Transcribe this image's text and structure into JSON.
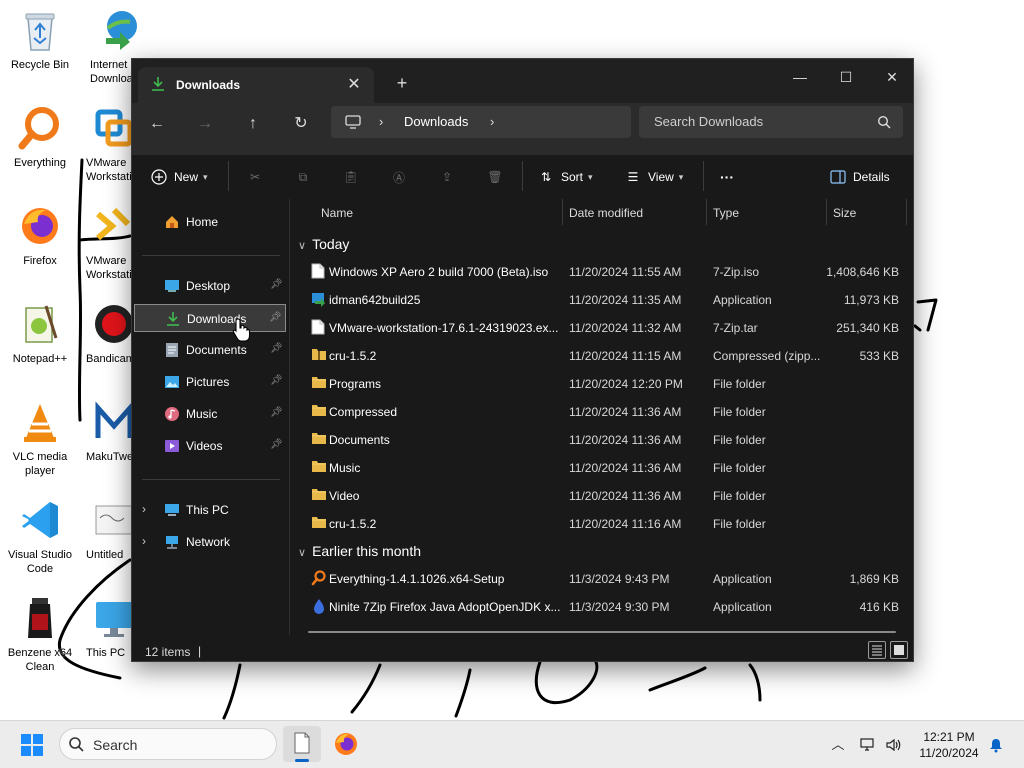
{
  "desktop": {
    "icons": [
      {
        "label": "Recycle Bin",
        "icon": "recycle-bin-icon"
      },
      {
        "label": "Internet Download",
        "icon": "idm-icon"
      },
      {
        "label": "Everything",
        "icon": "everything-icon"
      },
      {
        "label": "VMware Workstation",
        "icon": "vmware-icon"
      },
      {
        "label": "Firefox",
        "icon": "firefox-icon"
      },
      {
        "label": "VMware Workstation",
        "icon": "vmware-player-icon"
      },
      {
        "label": "Notepad++",
        "icon": "notepadpp-icon"
      },
      {
        "label": "Bandicam",
        "icon": "bandicam-icon"
      },
      {
        "label": "VLC media player",
        "icon": "vlc-icon"
      },
      {
        "label": "MakuTweaker",
        "icon": "makutweaker-icon"
      },
      {
        "label": "Visual Studio Code",
        "icon": "vscode-icon"
      },
      {
        "label": "Untitled",
        "icon": "untitled-image-icon"
      },
      {
        "label": "Benzene x64 Clean",
        "icon": "benzene-icon"
      },
      {
        "label": "This PC",
        "icon": "this-pc-icon"
      }
    ]
  },
  "window": {
    "tab_title": "Downloads",
    "new_tab": "+",
    "controls": {
      "minimize": "—",
      "maximize": "☐",
      "close": "✕"
    }
  },
  "address": {
    "crumbs": [
      "Downloads"
    ],
    "search_placeholder": "Search Downloads"
  },
  "commands": {
    "new_label": "New",
    "sort_label": "Sort",
    "view_label": "View",
    "more_label": "···",
    "details_label": "Details"
  },
  "nav": {
    "home": "Home",
    "quick_access": [
      {
        "label": "Desktop",
        "icon": "desktop-icon",
        "pinned": true
      },
      {
        "label": "Downloads",
        "icon": "downloads-icon",
        "pinned": true,
        "selected": true
      },
      {
        "label": "Documents",
        "icon": "documents-icon",
        "pinned": true
      },
      {
        "label": "Pictures",
        "icon": "pictures-icon",
        "pinned": true
      },
      {
        "label": "Music",
        "icon": "music-icon",
        "pinned": true
      },
      {
        "label": "Videos",
        "icon": "videos-icon",
        "pinned": true
      }
    ],
    "this_pc": "This PC",
    "network": "Network"
  },
  "columns": {
    "name": "Name",
    "date": "Date modified",
    "type": "Type",
    "size": "Size"
  },
  "groups": [
    {
      "label": "Today",
      "rows": [
        {
          "name": "Windows XP Aero 2 build 7000 (Beta).iso",
          "date": "11/20/2024 11:55 AM",
          "type": "7-Zip.iso",
          "size": "1,408,646 KB",
          "icon": "file-icon"
        },
        {
          "name": "idman642build25",
          "date": "11/20/2024 11:35 AM",
          "type": "Application",
          "size": "11,973 KB",
          "icon": "installer-icon"
        },
        {
          "name": "VMware-workstation-17.6.1-24319023.ex...",
          "date": "11/20/2024 11:32 AM",
          "type": "7-Zip.tar",
          "size": "251,340 KB",
          "icon": "file-icon"
        },
        {
          "name": "cru-1.5.2",
          "date": "11/20/2024 11:15 AM",
          "type": "Compressed (zipp...",
          "size": "533 KB",
          "icon": "zip-folder-icon"
        },
        {
          "name": "Programs",
          "date": "11/20/2024 12:20 PM",
          "type": "File folder",
          "size": "",
          "icon": "folder-icon"
        },
        {
          "name": "Compressed",
          "date": "11/20/2024 11:36 AM",
          "type": "File folder",
          "size": "",
          "icon": "folder-icon"
        },
        {
          "name": "Documents",
          "date": "11/20/2024 11:36 AM",
          "type": "File folder",
          "size": "",
          "icon": "folder-icon"
        },
        {
          "name": "Music",
          "date": "11/20/2024 11:36 AM",
          "type": "File folder",
          "size": "",
          "icon": "folder-icon"
        },
        {
          "name": "Video",
          "date": "11/20/2024 11:36 AM",
          "type": "File folder",
          "size": "",
          "icon": "folder-icon"
        },
        {
          "name": "cru-1.5.2",
          "date": "11/20/2024 11:16 AM",
          "type": "File folder",
          "size": "",
          "icon": "folder-icon"
        }
      ]
    },
    {
      "label": "Earlier this month",
      "rows": [
        {
          "name": "Everything-1.4.1.1026.x64-Setup",
          "date": "11/3/2024 9:43 PM",
          "type": "Application",
          "size": "1,869 KB",
          "icon": "everything-setup-icon"
        },
        {
          "name": "Ninite 7Zip Firefox Java AdoptOpenJDK x...",
          "date": "11/3/2024 9:30 PM",
          "type": "Application",
          "size": "416 KB",
          "icon": "ninite-icon"
        }
      ]
    }
  ],
  "status": {
    "items": "12 items",
    "separator": "|"
  },
  "taskbar": {
    "search_label": "Search",
    "time": "12:21 PM",
    "date": "11/20/2024"
  },
  "colors": {
    "accent": "#0a64c8",
    "window_bg": "#191919",
    "folder": "#e8b84a",
    "downloads_green": "#3fb950"
  }
}
